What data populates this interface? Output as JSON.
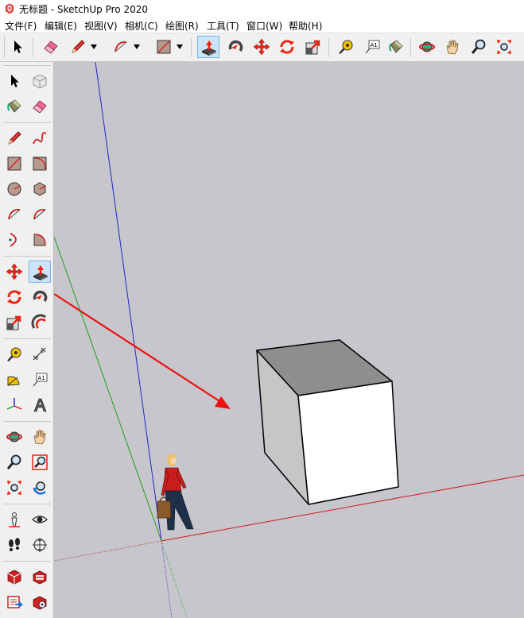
{
  "window": {
    "title": "无标题 - SketchUp Pro 2020"
  },
  "menu": {
    "items": [
      "文件(F)",
      "编辑(E)",
      "视图(V)",
      "相机(C)",
      "绘图(R)",
      "工具(T)",
      "窗口(W)",
      "帮助(H)"
    ]
  },
  "toolbar": {
    "tools": [
      "select",
      "eraser",
      "pencil",
      "arc",
      "rectangle",
      "push-pull",
      "follow-me",
      "move",
      "rotate",
      "scale",
      "tape-measure",
      "text",
      "paint-bucket",
      "orbit",
      "pan",
      "zoom",
      "zoom-extents"
    ],
    "active": "push-pull"
  },
  "left_toolbar": {
    "rows": [
      [
        "select",
        "make-component"
      ],
      [
        "paint-bucket",
        "eraser"
      ],
      [
        "line",
        "freehand"
      ],
      [
        "rectangle",
        "rotated-rectangle"
      ],
      [
        "circle",
        "polygon"
      ],
      [
        "arc",
        "two-point-arc"
      ],
      [
        "three-point-arc",
        "pie"
      ],
      [
        "move",
        "push-pull"
      ],
      [
        "rotate",
        "follow-me"
      ],
      [
        "scale",
        "offset"
      ],
      [
        "tape-measure",
        "dimension"
      ],
      [
        "protractor",
        "text"
      ],
      [
        "axes",
        "3d-text"
      ],
      [
        "orbit",
        "pan"
      ],
      [
        "zoom",
        "zoom-window"
      ],
      [
        "zoom-extents",
        "previous-view"
      ],
      [
        "position-camera",
        "look-around"
      ],
      [
        "walk",
        "section-plane"
      ],
      [
        "warehouse",
        "extension-warehouse"
      ],
      [
        "layout",
        "extension-manager"
      ]
    ],
    "active": "push-pull"
  },
  "text_tool": {
    "label": "A1"
  },
  "colors": {
    "viewport_bg": "#c6c6cc",
    "toolbar_bg": "#f0f0f0",
    "active_tool_bg": "#cce4f7",
    "axis_red": "#d01818",
    "axis_green": "#1ea01e",
    "axis_blue": "#2424c8",
    "annotation_arrow": "#ee1111"
  },
  "scene": {
    "objects": [
      "box",
      "human-figure"
    ],
    "annotation": "red-arrow"
  }
}
